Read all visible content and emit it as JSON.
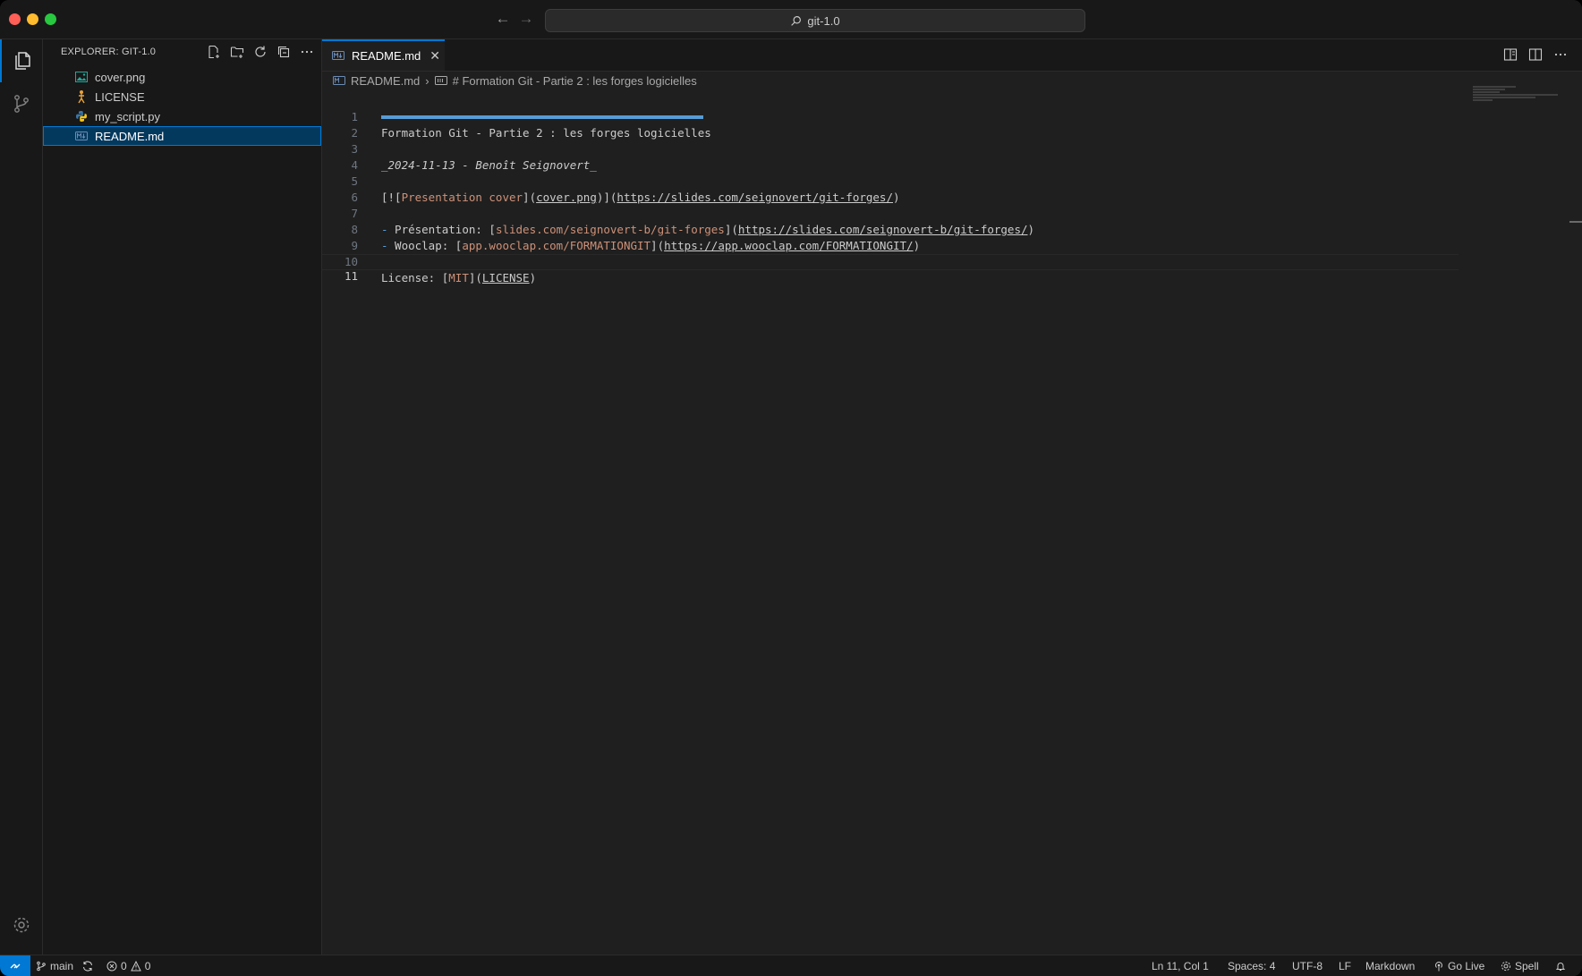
{
  "window": {
    "title": "git-1.0"
  },
  "sidebar": {
    "title": "EXPLORER: GIT-1.0",
    "files": [
      {
        "name": "cover.png",
        "icon": "image-file-icon"
      },
      {
        "name": "LICENSE",
        "icon": "license-file-icon"
      },
      {
        "name": "my_script.py",
        "icon": "python-file-icon"
      },
      {
        "name": "README.md",
        "icon": "markdown-file-icon",
        "selected": true
      }
    ]
  },
  "editor": {
    "tab_label": "README.md",
    "breadcrumb": {
      "file": "README.md",
      "symbol": "# Formation Git - Partie 2 : les forges logicielles"
    },
    "lines": {
      "l1": "Formation Git - Partie 2 : les forges logicielles",
      "l3": "_2024-11-13 - Benoît Seignovert_",
      "l5_a": "[![",
      "l5_b": "Presentation cover",
      "l5_c": "](",
      "l5_d": "cover.png",
      "l5_e": ")](",
      "l5_f": "https://slides.com/seignovert/git-forges/",
      "l5_g": ")",
      "l7_dash": "-",
      "l7_a": " Présentation: [",
      "l7_b": "slides.com/seignovert-b/git-forges",
      "l7_c": "](",
      "l7_d": "https://slides.com/seignovert-b/git-forges/",
      "l7_e": ")",
      "l8_dash": "-",
      "l8_a": " Wooclap: [",
      "l8_b": "app.wooclap.com/FORMATIONGIT",
      "l8_c": "](",
      "l8_d": "https://app.wooclap.com/FORMATIONGIT/",
      "l8_e": ")",
      "l10_a": "License: [",
      "l10_b": "MIT",
      "l10_c": "](",
      "l10_d": "LICENSE",
      "l10_e": ")"
    },
    "line_numbers": [
      "1",
      "2",
      "3",
      "4",
      "5",
      "6",
      "7",
      "8",
      "9",
      "10",
      "11"
    ]
  },
  "statusbar": {
    "branch": "main",
    "errors": "0",
    "warnings": "0",
    "position": "Ln 11, Col 1",
    "spaces": "Spaces: 4",
    "encoding": "UTF-8",
    "eol": "LF",
    "language": "Markdown",
    "go_live": "Go Live",
    "spell": "Spell"
  },
  "colors": {
    "accent": "#0078d4",
    "selection": "#04395e",
    "string": "#ce9178",
    "heading_rule": "#569cd6"
  }
}
